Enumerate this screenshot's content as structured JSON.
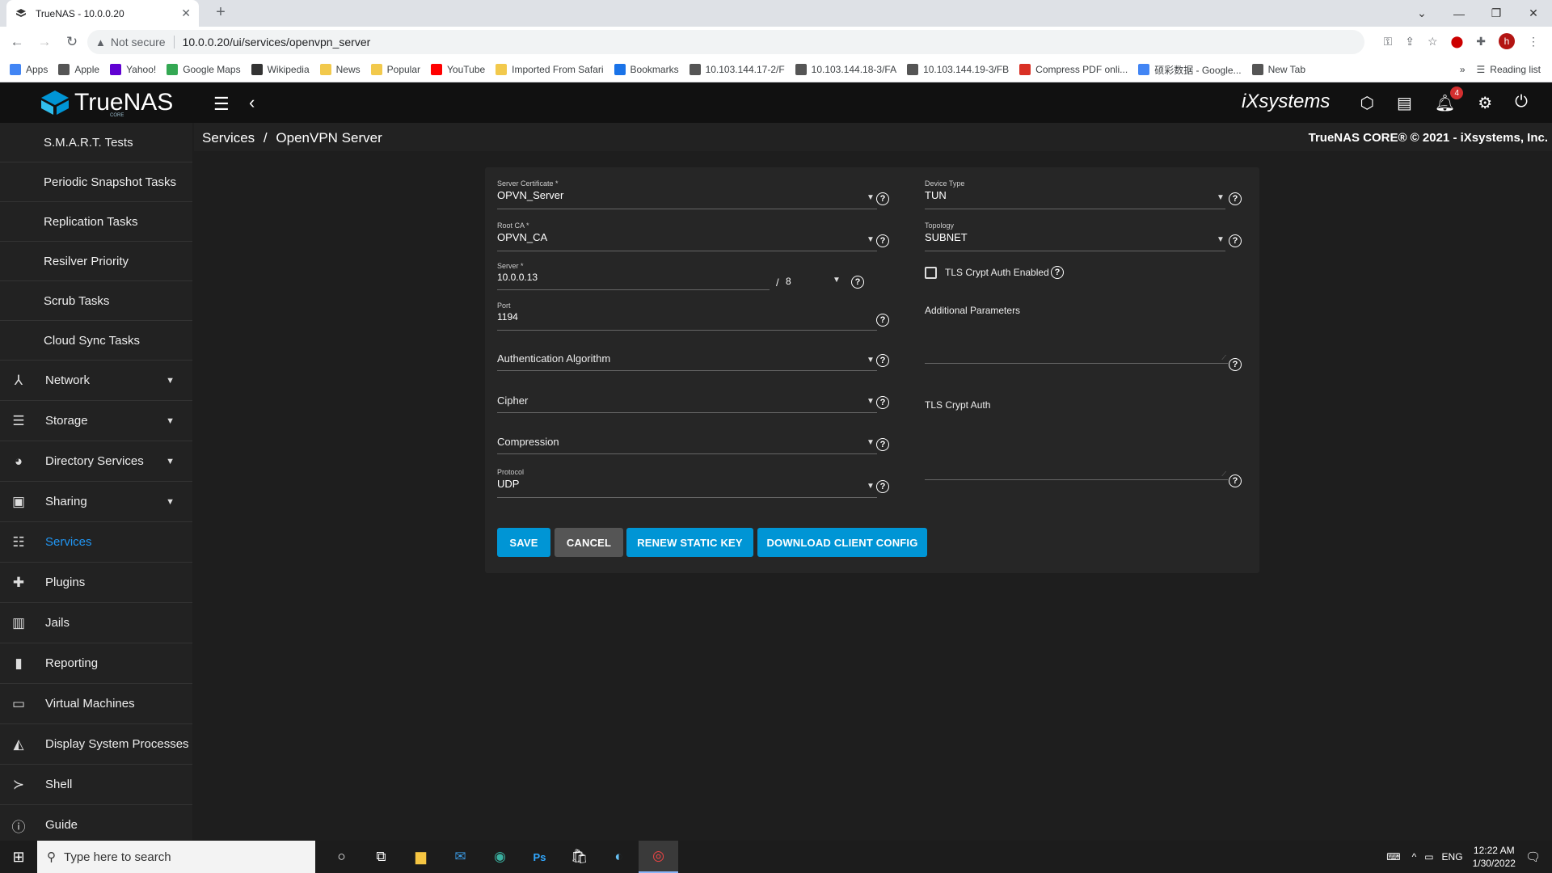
{
  "browser": {
    "tab_title": "TrueNAS - 10.0.0.20",
    "security_label": "Not secure",
    "url": "10.0.0.20/ui/services/openvpn_server",
    "profile_initial": "h",
    "bookmarks": [
      "Apps",
      "Apple",
      "Yahoo!",
      "Google Maps",
      "Wikipedia",
      "News",
      "Popular",
      "YouTube",
      "Imported From Safari",
      "Bookmarks",
      "10.103.144.17-2/F",
      "10.103.144.18-3/FA",
      "10.103.144.19-3/FB",
      "Compress PDF onli...",
      "硕彩数据 - Google...",
      "New Tab"
    ],
    "reading_list": "Reading list",
    "more_bookmarks": "»"
  },
  "header": {
    "logo_text": "TrueNAS",
    "logo_sub": "CORE",
    "vendor": "iXsystems",
    "notification_count": "4"
  },
  "breadcrumb": {
    "parent": "Services",
    "separator": "/",
    "current": "OpenVPN Server"
  },
  "copyright": "TrueNAS CORE® © 2021 - iXsystems, Inc.",
  "sidebar": {
    "subitems": [
      "S.M.A.R.T. Tests",
      "Periodic Snapshot Tasks",
      "Replication Tasks",
      "Resilver Priority",
      "Scrub Tasks",
      "Cloud Sync Tasks"
    ],
    "items": [
      {
        "label": "Network",
        "icon": "network-icon",
        "caret": true
      },
      {
        "label": "Storage",
        "icon": "storage-icon",
        "caret": true
      },
      {
        "label": "Directory Services",
        "icon": "directory-services-icon",
        "caret": true
      },
      {
        "label": "Sharing",
        "icon": "sharing-icon",
        "caret": true
      },
      {
        "label": "Services",
        "icon": "services-icon",
        "caret": false,
        "active": true
      },
      {
        "label": "Plugins",
        "icon": "plugins-icon",
        "caret": false
      },
      {
        "label": "Jails",
        "icon": "jails-icon",
        "caret": false
      },
      {
        "label": "Reporting",
        "icon": "reporting-icon",
        "caret": false
      },
      {
        "label": "Virtual Machines",
        "icon": "virtual-machines-icon",
        "caret": false
      },
      {
        "label": "Display System Processes",
        "icon": "processes-icon",
        "caret": false
      },
      {
        "label": "Shell",
        "icon": "shell-icon",
        "caret": false
      },
      {
        "label": "Guide",
        "icon": "guide-icon",
        "caret": false
      }
    ]
  },
  "form": {
    "server_certificate": {
      "label": "Server Certificate *",
      "value": "OPVN_Server"
    },
    "root_ca": {
      "label": "Root CA *",
      "value": "OPVN_CA"
    },
    "server": {
      "label": "Server *",
      "value": "10.0.0.13",
      "slash": "/",
      "netmask": "8"
    },
    "port": {
      "label": "Port",
      "value": "1194"
    },
    "auth_algorithm": {
      "label": "Authentication Algorithm"
    },
    "cipher": {
      "label": "Cipher"
    },
    "compression": {
      "label": "Compression"
    },
    "protocol": {
      "label": "Protocol",
      "value": "UDP"
    },
    "device_type": {
      "label": "Device Type",
      "value": "TUN"
    },
    "topology": {
      "label": "Topology",
      "value": "SUBNET"
    },
    "tls_crypt_enabled": {
      "label": "TLS Crypt Auth Enabled",
      "checked": false
    },
    "additional_parameters": {
      "label": "Additional Parameters"
    },
    "tls_crypt_auth": {
      "label": "TLS Crypt Auth"
    }
  },
  "buttons": {
    "save": "SAVE",
    "cancel": "CANCEL",
    "renew": "RENEW STATIC KEY",
    "download": "DOWNLOAD CLIENT CONFIG"
  },
  "taskbar": {
    "search_placeholder": "Type here to search",
    "language": "ENG",
    "time": "12:22 AM",
    "date": "1/30/2022"
  },
  "colors": {
    "accent": "#0095d5",
    "active_nav": "#2196f3",
    "background": "#1e1e1e"
  }
}
